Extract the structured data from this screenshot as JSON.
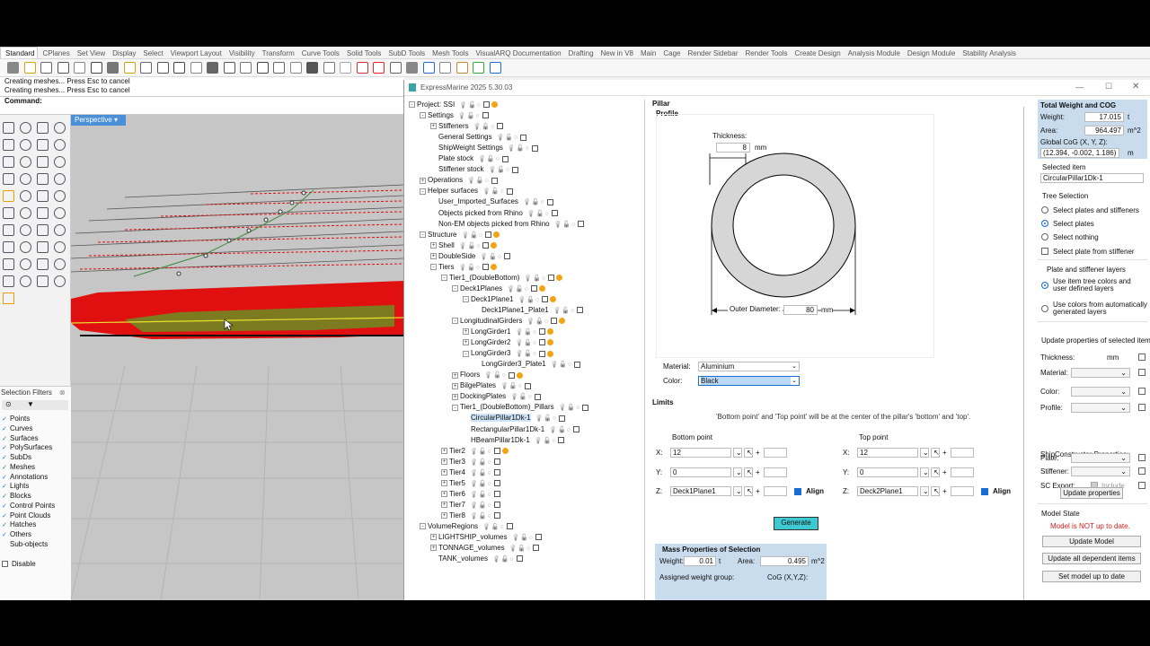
{
  "ribbon_tabs": [
    "Standard",
    "CPlanes",
    "Set View",
    "Display",
    "Select",
    "Viewport Layout",
    "Visibility",
    "Transform",
    "Curve Tools",
    "Solid Tools",
    "SubD Tools",
    "Mesh Tools",
    "VisualARQ Documentation",
    "Drafting",
    "New in V8",
    "Main",
    "Cage",
    "Render Sidebar",
    "Render Tools",
    "Create Design",
    "Analysis Module",
    "Design Module",
    "Stability Analysis"
  ],
  "command": {
    "history": [
      "Creating meshes... Press Esc to cancel",
      "Creating meshes... Press Esc to cancel"
    ],
    "label": "Command:"
  },
  "viewport": {
    "label": "Perspective"
  },
  "selection_filters": {
    "title": "Selection Filters",
    "items": [
      "Points",
      "Curves",
      "Surfaces",
      "PolySurfaces",
      "SubDs",
      "Meshes",
      "Annotations",
      "Lights",
      "Blocks",
      "Control Points",
      "Point Clouds",
      "Hatches",
      "Others",
      "Sub-objects"
    ],
    "disable": "Disable"
  },
  "em_window": {
    "title": "ExpressMarine 2025 5.30.03"
  },
  "tree": [
    {
      "label": "Project: SSI",
      "d": 0,
      "t": "-",
      "w": true
    },
    {
      "label": "Settings",
      "d": 1,
      "t": "-"
    },
    {
      "label": "Stiffeners",
      "d": 2,
      "t": "+"
    },
    {
      "label": "General Settings",
      "d": 2,
      "t": ""
    },
    {
      "label": "ShipWeight Settings",
      "d": 2,
      "t": ""
    },
    {
      "label": "Plate stock",
      "d": 2,
      "t": ""
    },
    {
      "label": "Stiffener stock",
      "d": 2,
      "t": ""
    },
    {
      "label": "Operations",
      "d": 1,
      "t": "+"
    },
    {
      "label": "Helper surfaces",
      "d": 1,
      "t": "-"
    },
    {
      "label": "User_Imported_Surfaces",
      "d": 2,
      "t": ""
    },
    {
      "label": "Objects picked from Rhino",
      "d": 2,
      "t": ""
    },
    {
      "label": "Non-EM objects picked from Rhino",
      "d": 2,
      "t": ""
    },
    {
      "label": "Structure",
      "d": 1,
      "t": "-",
      "w": true
    },
    {
      "label": "Shell",
      "d": 2,
      "t": "+",
      "w": true
    },
    {
      "label": "DoubleSide",
      "d": 2,
      "t": "+"
    },
    {
      "label": "Tiers",
      "d": 2,
      "t": "-",
      "w": true
    },
    {
      "label": "Tier1_(DoubleBottom)",
      "d": 3,
      "t": "-",
      "w": true
    },
    {
      "label": "Deck1Planes",
      "d": 4,
      "t": "-",
      "w": true
    },
    {
      "label": "Deck1Plane1",
      "d": 5,
      "t": "-",
      "w": true
    },
    {
      "label": "Deck1Plane1_Plate1",
      "d": 6,
      "t": ""
    },
    {
      "label": "LongitudinalGirders",
      "d": 4,
      "t": "-",
      "w": true
    },
    {
      "label": "LongGirder1",
      "d": 5,
      "t": "+",
      "w": true
    },
    {
      "label": "LongGirder2",
      "d": 5,
      "t": "+",
      "w": true
    },
    {
      "label": "LongGirder3",
      "d": 5,
      "t": "-",
      "w": true
    },
    {
      "label": "LongGirder3_Plate1",
      "d": 6,
      "t": ""
    },
    {
      "label": "Floors",
      "d": 4,
      "t": "+",
      "w": true
    },
    {
      "label": "BilgePlates",
      "d": 4,
      "t": "+"
    },
    {
      "label": "DockingPlates",
      "d": 4,
      "t": "+"
    },
    {
      "label": "Tier1_(DoubleBottom)_Pillars",
      "d": 4,
      "t": "-"
    },
    {
      "label": "CircularPillar1Dk-1",
      "d": 5,
      "t": "",
      "sel": true
    },
    {
      "label": "RectangularPillar1Dk-1",
      "d": 5,
      "t": ""
    },
    {
      "label": "HBeamPillar1Dk-1",
      "d": 5,
      "t": ""
    },
    {
      "label": "Tier2",
      "d": 3,
      "t": "+",
      "w": true
    },
    {
      "label": "Tier3",
      "d": 3,
      "t": "+"
    },
    {
      "label": "Tier4",
      "d": 3,
      "t": "+"
    },
    {
      "label": "Tier5",
      "d": 3,
      "t": "+"
    },
    {
      "label": "Tier6",
      "d": 3,
      "t": "+"
    },
    {
      "label": "Tier7",
      "d": 3,
      "t": "+"
    },
    {
      "label": "Tier8",
      "d": 3,
      "t": "+"
    },
    {
      "label": "VolumeRegions",
      "d": 1,
      "t": "-"
    },
    {
      "label": "LIGHTSHIP_volumes",
      "d": 2,
      "t": "+"
    },
    {
      "label": "TONNAGE_volumes",
      "d": 2,
      "t": "+"
    },
    {
      "label": "TANK_volumes",
      "d": 2,
      "t": ""
    }
  ],
  "pillar": {
    "title": "Pillar",
    "profile": "Profile",
    "thickness_label": "Thickness:",
    "thickness_value": "8",
    "thickness_unit": "mm",
    "outer_label": "Outer Diameter:",
    "outer_value": "80",
    "outer_unit": "mm",
    "material_label": "Material:",
    "material_value": "Aluminium",
    "color_label": "Color:",
    "color_value": "Black",
    "limits_title": "Limits",
    "limits_note": "'Bottom point' and 'Top point' will be at the center of the pillar's 'bottom' and 'top'.",
    "bottom": {
      "title": "Bottom point",
      "x": "12",
      "y": "0",
      "z": "Deck1Plane1",
      "align": "Align"
    },
    "top": {
      "title": "Top point",
      "x": "12",
      "y": "0",
      "z": "Deck2Plane1",
      "align": "Align"
    },
    "axis_x": "X:",
    "axis_y": "Y:",
    "axis_z": "Z:",
    "plus": "+",
    "generate": "Generate",
    "mass": {
      "title": "Mass Properties of Selection",
      "weight_label": "Weight:",
      "weight_value": "0.01",
      "weight_unit": "t",
      "area_label": "Area:",
      "area_value": "0.495",
      "area_unit": "m^2",
      "group_label": "Assigned weight group:",
      "cog_label": "CoG (X,Y,Z):"
    }
  },
  "right": {
    "twc_title": "Total Weight and COG",
    "weight_label": "Weight:",
    "weight_value": "17.015",
    "weight_unit": "t",
    "area_label": "Area:",
    "area_value": "964.497",
    "area_unit": "m^2",
    "cog_label": "Global CoG (X, Y, Z):",
    "cog_value": "(12.394, -0.002, 1.186)",
    "cog_unit": "m",
    "selected_label": "Selected item",
    "selected_value": "CircularPillar1Dk-1",
    "tree_sel_title": "Tree Selection",
    "tree_sel": [
      "Select plates and stiffeners",
      "Select plates",
      "Select nothing",
      "Select plate from stiffener"
    ],
    "layers_title": "Plate and stiffener layers",
    "layers_opt1": "Use item tree colors and user defined layers",
    "layers_opt2": "Use colors from automatically generated layers",
    "update_title": "Update properties of selected items",
    "prop_thickness": "Thickness:",
    "prop_thickness_unit": "mm",
    "prop_material": "Material:",
    "prop_color": "Color:",
    "prop_profile": "Profile:",
    "sc_title": "ShipConstructor Properties:",
    "sc_plate": "Plate:",
    "sc_stiffener": "Stiffener:",
    "sc_export": "SC Export:",
    "sc_include": "Include",
    "update_props_btn": "Update properties",
    "model_state_title": "Model State",
    "model_state_msg": "Model is NOT up to date.",
    "update_model_btn": "Update Model",
    "update_dep_btn": "Update all dependent items",
    "set_uptodate_btn": "Set model up to date"
  },
  "colors": {
    "accent": "#1a6fd6",
    "highlight": "#cde3f7",
    "generate": "#3fc9d0",
    "hull_red": "#e01010",
    "warn": "#f1a514",
    "panel_blue": "#c9dcee"
  }
}
